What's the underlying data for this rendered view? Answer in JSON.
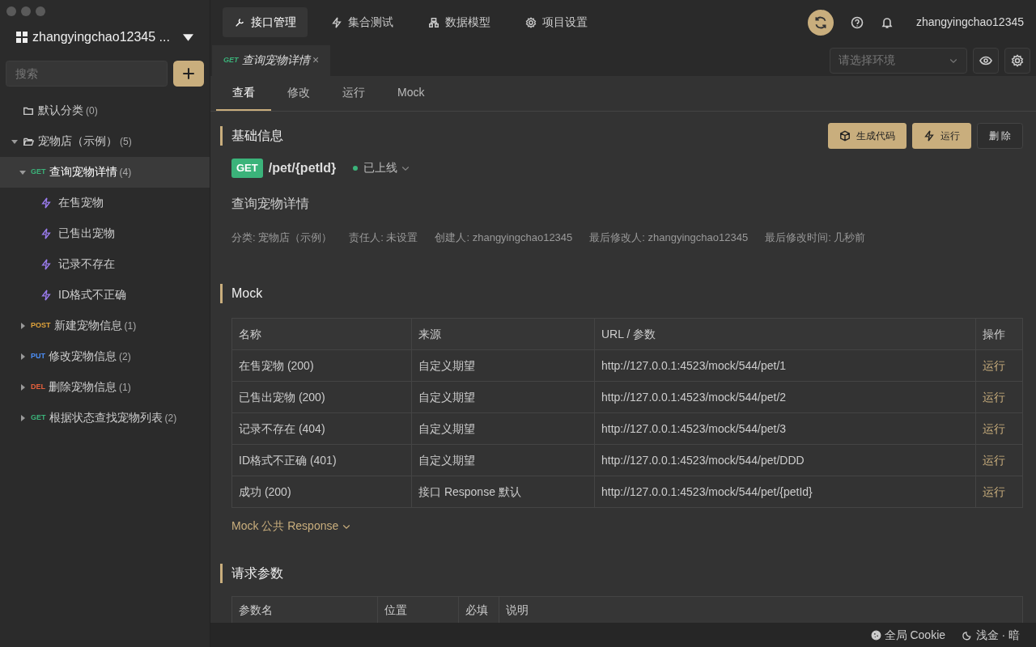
{
  "sidebar": {
    "workspace": "zhangyingchao12345 ...",
    "search": {
      "placeholder": "搜索"
    },
    "tree": [
      {
        "kind": "folder",
        "label": "默认分类",
        "count": "(0)",
        "expanded": false,
        "selected": false
      },
      {
        "kind": "folder",
        "label": "宠物店（示例）",
        "count": "(5)",
        "expanded": true,
        "selected": false,
        "children": [
          {
            "kind": "api",
            "method": "GET",
            "color": "#3bb37a",
            "label": "查询宠物详情",
            "count": "(4)",
            "expanded": true,
            "selected": true,
            "children": [
              {
                "kind": "case",
                "label": "在售宠物",
                "selected": false
              },
              {
                "kind": "case",
                "label": "已售出宠物",
                "selected": false
              },
              {
                "kind": "case",
                "label": "记录不存在",
                "selected": false
              },
              {
                "kind": "case",
                "label": "ID格式不正确",
                "selected": false
              }
            ]
          },
          {
            "kind": "api",
            "method": "POST",
            "color": "#e0a33b",
            "label": "新建宠物信息",
            "count": "(1)",
            "expanded": false,
            "selected": false
          },
          {
            "kind": "api",
            "method": "PUT",
            "color": "#4c8ef5",
            "label": "修改宠物信息",
            "count": "(2)",
            "expanded": false,
            "selected": false
          },
          {
            "kind": "api",
            "method": "DEL",
            "color": "#e5603c",
            "label": "删除宠物信息",
            "count": "(1)",
            "expanded": false,
            "selected": false
          },
          {
            "kind": "api",
            "method": "GET",
            "color": "#3bb37a",
            "label": "根据状态查找宠物列表",
            "count": "(2)",
            "expanded": false,
            "selected": false
          }
        ]
      }
    ]
  },
  "top_nav": [
    {
      "kind": "wrench",
      "label": "接口管理",
      "selected": true
    },
    {
      "kind": "bolt",
      "label": "集合测试",
      "selected": false
    },
    {
      "kind": "model",
      "label": "数据模型",
      "selected": false
    },
    {
      "kind": "gear",
      "label": "项目设置",
      "selected": false
    }
  ],
  "user": "zhangyingchao12345",
  "doc_tabs": [
    {
      "method": "GET",
      "color": "#3bb37a",
      "label": "查询宠物详情",
      "close": "×"
    }
  ],
  "env_select": {
    "placeholder": "请选择环境"
  },
  "view_tabs": [
    {
      "label": "查看",
      "selected": true
    },
    {
      "label": "修改",
      "selected": false
    },
    {
      "label": "运行",
      "selected": false
    },
    {
      "label": "Mock",
      "selected": false
    }
  ],
  "basic": {
    "title": "基础信息",
    "buttons": [
      {
        "kind": "code",
        "label": "生成代码"
      },
      {
        "kind": "run",
        "label": "运行"
      },
      {
        "kind": "delete",
        "label": "删 除"
      }
    ],
    "method": "GET",
    "path": "/pet/{petId}",
    "status": "已上线",
    "name": "查询宠物详情",
    "meta": [
      "分类: 宠物店（示例）",
      "责任人: 未设置",
      "创建人: zhangyingchao12345",
      "最后修改人: zhangyingchao12345",
      "最后修改时间: 几秒前"
    ]
  },
  "mock": {
    "title": "Mock",
    "columns": [
      "名称",
      "来源",
      "URL / 参数",
      "操作"
    ],
    "rows": [
      [
        "在售宠物 (200)",
        "自定义期望",
        "http://127.0.0.1:4523/mock/544/pet/1",
        "运行"
      ],
      [
        "已售出宠物 (200)",
        "自定义期望",
        "http://127.0.0.1:4523/mock/544/pet/2",
        "运行"
      ],
      [
        "记录不存在 (404)",
        "自定义期望",
        "http://127.0.0.1:4523/mock/544/pet/3",
        "运行"
      ],
      [
        "ID格式不正确 (401)",
        "自定义期望",
        "http://127.0.0.1:4523/mock/544/pet/DDD",
        "运行"
      ],
      [
        "成功 (200)",
        "接口 Response 默认",
        "http://127.0.0.1:4523/mock/544/pet/{petId}",
        "运行"
      ]
    ],
    "footer_link": "Mock 公共 Response"
  },
  "params": {
    "title": "请求参数",
    "columns": [
      "参数名",
      "位置",
      "必填",
      "说明"
    ]
  },
  "status_bar": [
    {
      "kind": "cookie",
      "label": "全局 Cookie"
    },
    {
      "kind": "moon",
      "label": "浅金 · 暗"
    }
  ]
}
